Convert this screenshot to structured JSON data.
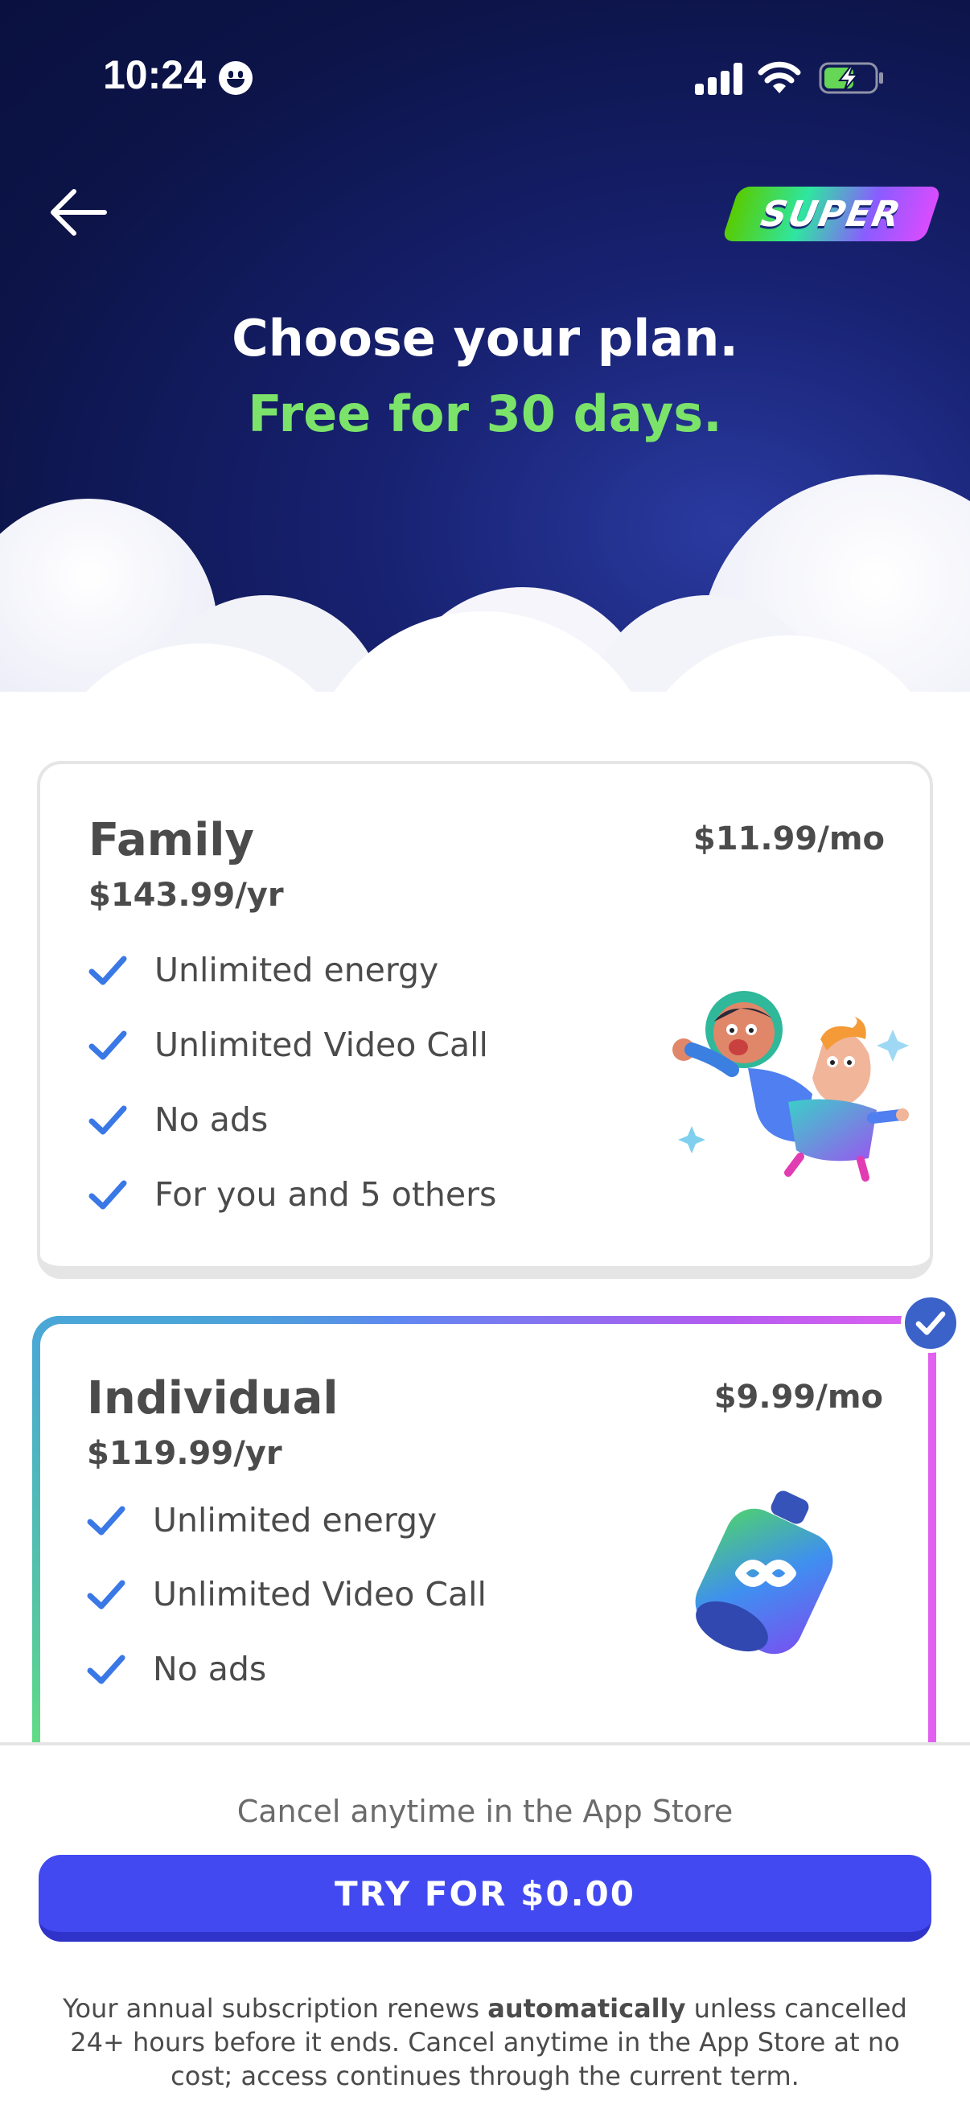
{
  "status_bar": {
    "time": "10:24"
  },
  "header": {
    "back_icon": "arrow-left-icon",
    "badge_text": "SUPER",
    "title": "Choose your plan.",
    "subtitle": "Free for 30 days."
  },
  "plans": [
    {
      "name": "Family",
      "price_year": "$143.99/yr",
      "price_month": "$11.99/mo",
      "features": [
        "Unlimited energy",
        "Unlimited Video Call",
        "No ads",
        "For you and 5 others"
      ],
      "selected": false
    },
    {
      "name": "Individual",
      "price_year": "$119.99/yr",
      "price_month": "$9.99/mo",
      "features": [
        "Unlimited energy",
        "Unlimited Video Call",
        "No ads"
      ],
      "selected": true
    }
  ],
  "footer": {
    "cancel_note": "Cancel anytime in the App Store",
    "cta_label": "TRY FOR $0.00",
    "legal_prefix": "Your annual subscription renews ",
    "legal_bold": "automatically",
    "legal_suffix": " unless cancelled 24+ hours before it ends. Cancel anytime in the App Store at no cost; access continues through the current term."
  },
  "colors": {
    "hero_bg": "#0c1448",
    "subtitle_green": "#7be36a",
    "check_blue": "#3a78e6",
    "cta_blue": "#4249f0"
  }
}
